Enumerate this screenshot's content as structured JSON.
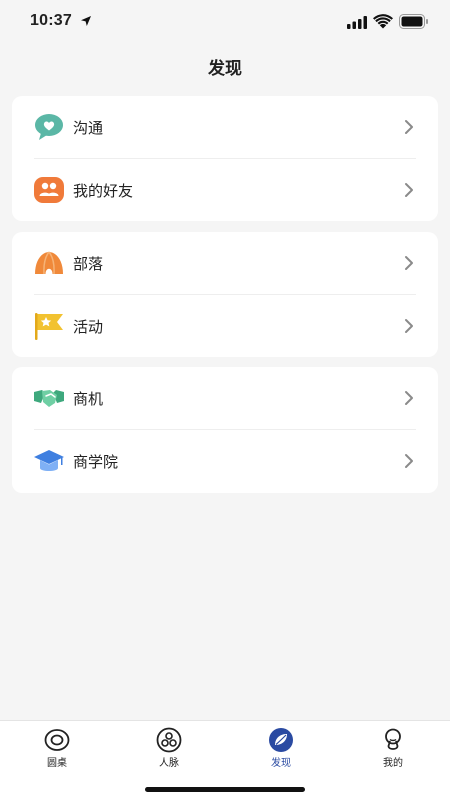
{
  "status_bar": {
    "time": "10:37"
  },
  "header": {
    "title": "发现"
  },
  "menu": {
    "communication": {
      "label": "沟通",
      "icon": "chat-heart-icon",
      "color": "#5bb7a6"
    },
    "friends": {
      "label": "我的好友",
      "icon": "people-icon",
      "color": "#f07a3a"
    },
    "tribe": {
      "label": "部落",
      "icon": "tent-icon",
      "color": "#f0893a"
    },
    "activity": {
      "label": "活动",
      "icon": "star-flag-icon",
      "color": "#f2c230"
    },
    "business": {
      "label": "商机",
      "icon": "handshake-icon",
      "color": "#4dbb8e"
    },
    "academy": {
      "label": "商学院",
      "icon": "graduation-cap-icon",
      "color": "#3f7fe0"
    }
  },
  "tabbar": {
    "items": [
      {
        "label": "圆桌",
        "icon": "round-table-icon"
      },
      {
        "label": "人脉",
        "icon": "network-icon"
      },
      {
        "label": "发现",
        "icon": "discover-icon",
        "active": true
      },
      {
        "label": "我的",
        "icon": "profile-icon"
      }
    ],
    "active_color": "#2a4aa2"
  }
}
